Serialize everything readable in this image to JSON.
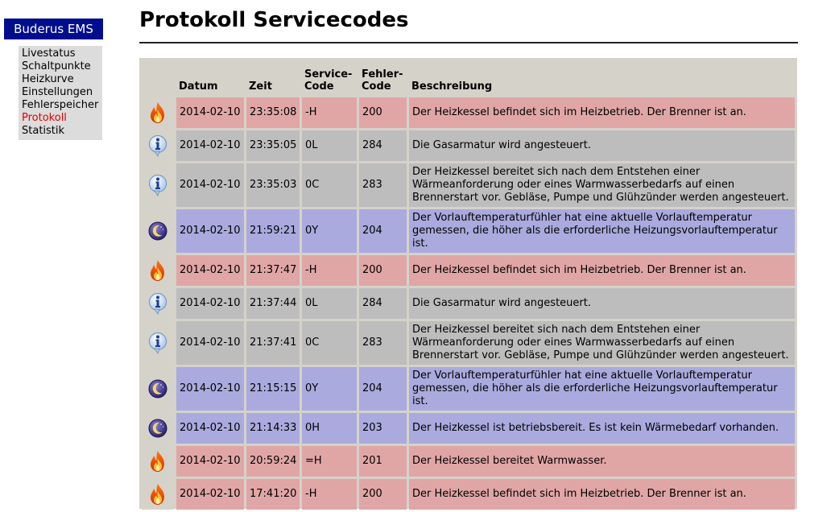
{
  "brand": "Buderus EMS",
  "nav": {
    "items": [
      "Livestatus",
      "Schaltpunkte",
      "Heizkurve",
      "Einstellungen",
      "Fehlerspeicher",
      "Protokoll",
      "Statistik"
    ],
    "active": "Protokoll",
    "active_color": "#e00000"
  },
  "page_title": "Protokoll Servicecodes",
  "table": {
    "headers": {
      "datum": "Datum",
      "zeit": "Zeit",
      "service_line1": "Service-",
      "service_line2": "Code",
      "fehler_line1": "Fehler-",
      "fehler_line2": "Code",
      "beschreibung": "Beschreibung"
    },
    "rows": [
      {
        "icon": "fire-icon",
        "datum": "2014-02-10",
        "zeit": "23:35:08",
        "service": "-H",
        "fehler": "200",
        "beschreibung": "Der Heizkessel befindet sich im Heizbetrieb. Der Brenner ist an."
      },
      {
        "icon": "info-icon",
        "datum": "2014-02-10",
        "zeit": "23:35:05",
        "service": "0L",
        "fehler": "284",
        "beschreibung": "Die Gasarmatur wird angesteuert."
      },
      {
        "icon": "info-icon",
        "datum": "2014-02-10",
        "zeit": "23:35:03",
        "service": "0C",
        "fehler": "283",
        "beschreibung": "Der Heizkessel bereitet sich nach dem Entstehen einer Wärmeanforderung oder eines Warmwasserbedarfs auf einen Brennerstart vor. Gebläse, Pumpe und Glühzünder werden angesteuert."
      },
      {
        "icon": "moon-icon",
        "datum": "2014-02-10",
        "zeit": "21:59:21",
        "service": "0Y",
        "fehler": "204",
        "beschreibung": "Der Vorlauftemperaturfühler hat eine aktuelle Vorlauftemperatur gemessen, die höher als die erforderliche Heizungsvorlauftemperatur ist."
      },
      {
        "icon": "fire-icon",
        "datum": "2014-02-10",
        "zeit": "21:37:47",
        "service": "-H",
        "fehler": "200",
        "beschreibung": "Der Heizkessel befindet sich im Heizbetrieb. Der Brenner ist an."
      },
      {
        "icon": "info-icon",
        "datum": "2014-02-10",
        "zeit": "21:37:44",
        "service": "0L",
        "fehler": "284",
        "beschreibung": "Die Gasarmatur wird angesteuert."
      },
      {
        "icon": "info-icon",
        "datum": "2014-02-10",
        "zeit": "21:37:41",
        "service": "0C",
        "fehler": "283",
        "beschreibung": "Der Heizkessel bereitet sich nach dem Entstehen einer Wärmeanforderung oder eines Warmwasserbedarfs auf einen Brennerstart vor. Gebläse, Pumpe und Glühzünder werden angesteuert."
      },
      {
        "icon": "moon-icon",
        "datum": "2014-02-10",
        "zeit": "21:15:15",
        "service": "0Y",
        "fehler": "204",
        "beschreibung": "Der Vorlauftemperaturfühler hat eine aktuelle Vorlauftemperatur gemessen, die höher als die erforderliche Heizungsvorlauftemperatur ist."
      },
      {
        "icon": "moon-icon",
        "datum": "2014-02-10",
        "zeit": "21:14:33",
        "service": "0H",
        "fehler": "203",
        "beschreibung": "Der Heizkessel ist betriebsbereit. Es ist kein Wärmebedarf vorhanden."
      },
      {
        "icon": "fire-icon",
        "datum": "2014-02-10",
        "zeit": "20:59:24",
        "service": "=H",
        "fehler": "201",
        "beschreibung": "Der Heizkessel bereitet Warmwasser."
      },
      {
        "icon": "fire-icon",
        "datum": "2014-02-10",
        "zeit": "17:41:20",
        "service": "-H",
        "fehler": "200",
        "beschreibung": "Der Heizkessel befindet sich im Heizbetrieb. Der Brenner ist an."
      }
    ]
  },
  "colors": {
    "brand_bg": "#000e8e",
    "nav_bg": "#dcdcdc",
    "table_bg": "#d5d2ca",
    "row_fire": "#e0a6a6",
    "row_info": "#bdbdbd",
    "row_moon": "#aaaade"
  }
}
